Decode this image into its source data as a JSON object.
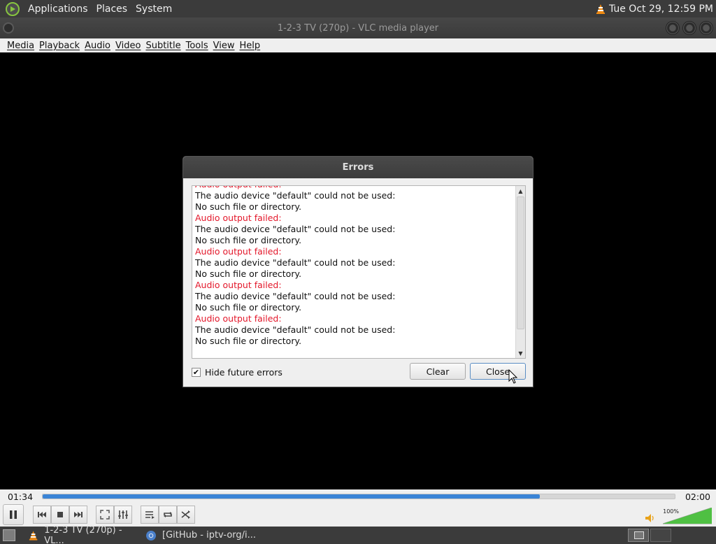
{
  "top_panel": {
    "menus": [
      "Applications",
      "Places",
      "System"
    ],
    "clock": "Tue Oct 29, 12:59 PM"
  },
  "window": {
    "title": "1-2-3 TV (270p) - VLC media player"
  },
  "menubar": {
    "items": [
      "Media",
      "Playback",
      "Audio",
      "Video",
      "Subtitle",
      "Tools",
      "View",
      "Help"
    ]
  },
  "errors_dialog": {
    "title": "Errors",
    "log_lines": [
      {
        "text": "Audio output failed:",
        "type": "error"
      },
      {
        "text": "The audio device \"default\" could not be used:",
        "type": "info"
      },
      {
        "text": "No such file or directory.",
        "type": "info"
      },
      {
        "text": "Audio output failed:",
        "type": "error"
      },
      {
        "text": "The audio device \"default\" could not be used:",
        "type": "info"
      },
      {
        "text": "No such file or directory.",
        "type": "info"
      },
      {
        "text": "Audio output failed:",
        "type": "error"
      },
      {
        "text": "The audio device \"default\" could not be used:",
        "type": "info"
      },
      {
        "text": "No such file or directory.",
        "type": "info"
      },
      {
        "text": "Audio output failed:",
        "type": "error"
      },
      {
        "text": "The audio device \"default\" could not be used:",
        "type": "info"
      },
      {
        "text": "No such file or directory.",
        "type": "info"
      },
      {
        "text": "Audio output failed:",
        "type": "error"
      },
      {
        "text": "The audio device \"default\" could not be used:",
        "type": "info"
      },
      {
        "text": "No such file or directory.",
        "type": "info"
      }
    ],
    "hide_future_errors": {
      "label": "Hide future errors",
      "checked": true
    },
    "clear_label": "Clear",
    "close_label": "Close"
  },
  "player": {
    "elapsed": "01:34",
    "total": "02:00",
    "progress_fraction": 0.787,
    "volume_percent": "100%",
    "volume_level": 1.0
  },
  "taskbar": {
    "tasks": [
      "1-2-3 TV (270p) - VL...",
      "[GitHub - iptv-org/i..."
    ]
  },
  "colors": {
    "error_text": "#e3172a",
    "progress_fill": "#3a84d6",
    "volume_fill": "#4fc043",
    "vlc_orange": "#f08a12"
  }
}
